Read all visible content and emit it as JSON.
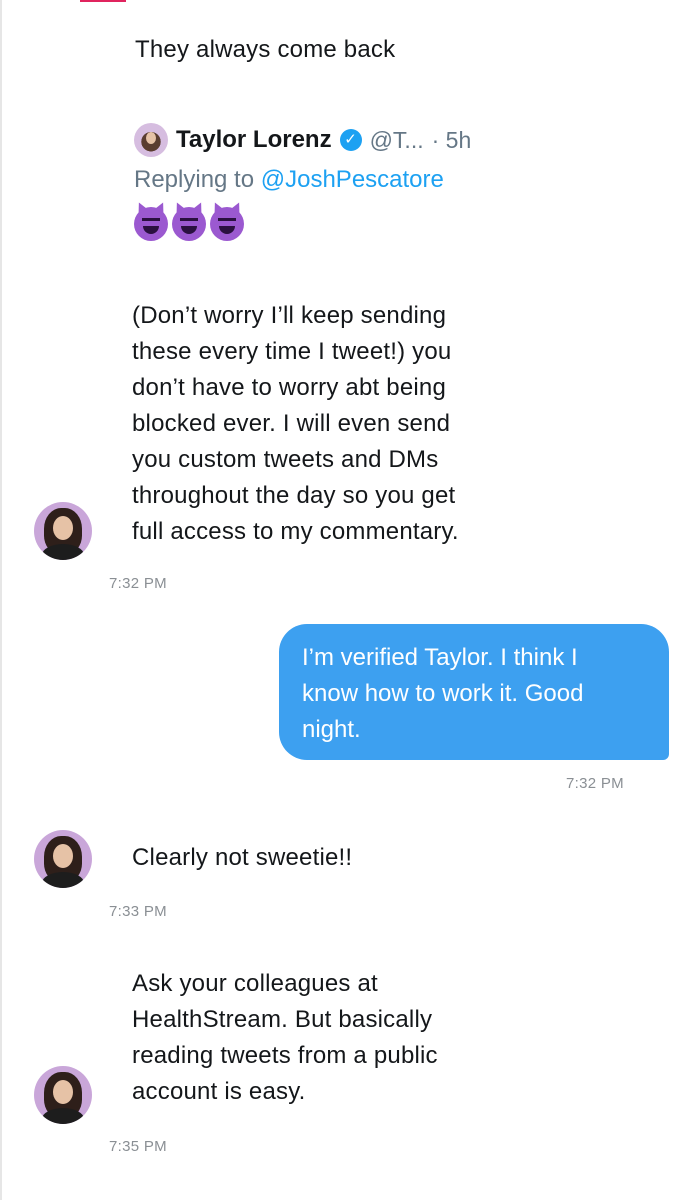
{
  "header_text": "They always come back",
  "quoted_tweet": {
    "name": "Taylor Lorenz",
    "verified_glyph": "✓",
    "handle": "@T...",
    "time": "· 5h",
    "replying_prefix": "Replying to",
    "replying_to": "@JoshPescatore",
    "emoji_icons": [
      "smiling-devil-icon",
      "smiling-devil-icon",
      "smiling-devil-icon"
    ]
  },
  "messages": [
    {
      "direction": "incoming",
      "lines": [
        "(Don’t worry I’ll keep sending",
        "these every time I tweet!) you",
        "don’t have to worry abt being",
        "blocked ever. I will even send",
        "you custom tweets and DMs",
        "throughout the day so you get",
        "full access to my commentary."
      ],
      "time": "7:32 PM"
    },
    {
      "direction": "outgoing",
      "lines": [
        "I’m verified Taylor. I think I",
        "know how to work it. Good",
        "night."
      ],
      "time": "7:32 PM"
    },
    {
      "direction": "incoming",
      "lines": [
        "Clearly not sweetie!!"
      ],
      "time": "7:33 PM"
    },
    {
      "direction": "incoming",
      "lines": [
        "Ask your colleagues at",
        "HealthStream. But basically",
        "reading tweets from a public",
        "account is easy."
      ],
      "time": "7:35 PM"
    }
  ],
  "colors": {
    "outgoing_bubble": "#3da0f0",
    "link": "#1da1f2",
    "timestamp": "#8a8f94",
    "verified_badge": "#1da1f2"
  }
}
